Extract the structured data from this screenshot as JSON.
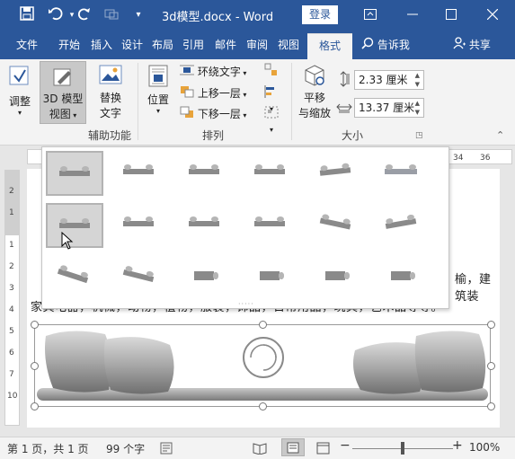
{
  "titlebar": {
    "title": "3d模型.docx  -  Word",
    "login": "登录",
    "icons": [
      "save-icon",
      "undo-icon",
      "redo-icon",
      "print-preview-icon",
      "customize-qat-icon",
      "ribbon-display-options-icon",
      "minimize-icon",
      "maximize-icon",
      "close-icon"
    ]
  },
  "tabs": {
    "items": [
      "文件",
      "开始",
      "插入",
      "设计",
      "布局",
      "引用",
      "邮件",
      "审阅",
      "视图",
      "格式"
    ],
    "active": "格式",
    "tell_me": "告诉我",
    "share": "共享"
  },
  "ribbon": {
    "adjust": "调整",
    "view3d_line1": "3D 模型",
    "view3d_line2": "视图",
    "alt_line1": "替换",
    "alt_line2": "文字",
    "group_accessibility": "辅助功能",
    "position": "位置",
    "wrap_text": "环绕文字",
    "bring_forward": "上移一层",
    "send_backward": "下移一层",
    "group_arrange": "排列",
    "pan_line1": "平移",
    "pan_line2": "与缩放",
    "height": "2.33 厘米",
    "width": "13.37 厘米",
    "group_size": "大小"
  },
  "ruler": {
    "top": [
      "34",
      "36"
    ],
    "left": [
      "2",
      "1",
      "1",
      "1",
      "2",
      "3",
      "4",
      "5",
      "6",
      "7",
      "8",
      "9",
      "10"
    ]
  },
  "document": {
    "line1_fragment": "榆，建筑装",
    "line2": "家具电器，机械，动物，植物，服装，饰品，日常用品，玩具，艺术品等等。"
  },
  "gallery": {
    "rows": 3,
    "cols": 6,
    "selected_index": 6
  },
  "status": {
    "page": "第 1 页，共 1 页",
    "words": "99 个字",
    "zoom": "100%",
    "zoom_fraction": 0.5
  },
  "colors": {
    "accent": "#2b579a",
    "ribbon": "#f3f3f3"
  }
}
